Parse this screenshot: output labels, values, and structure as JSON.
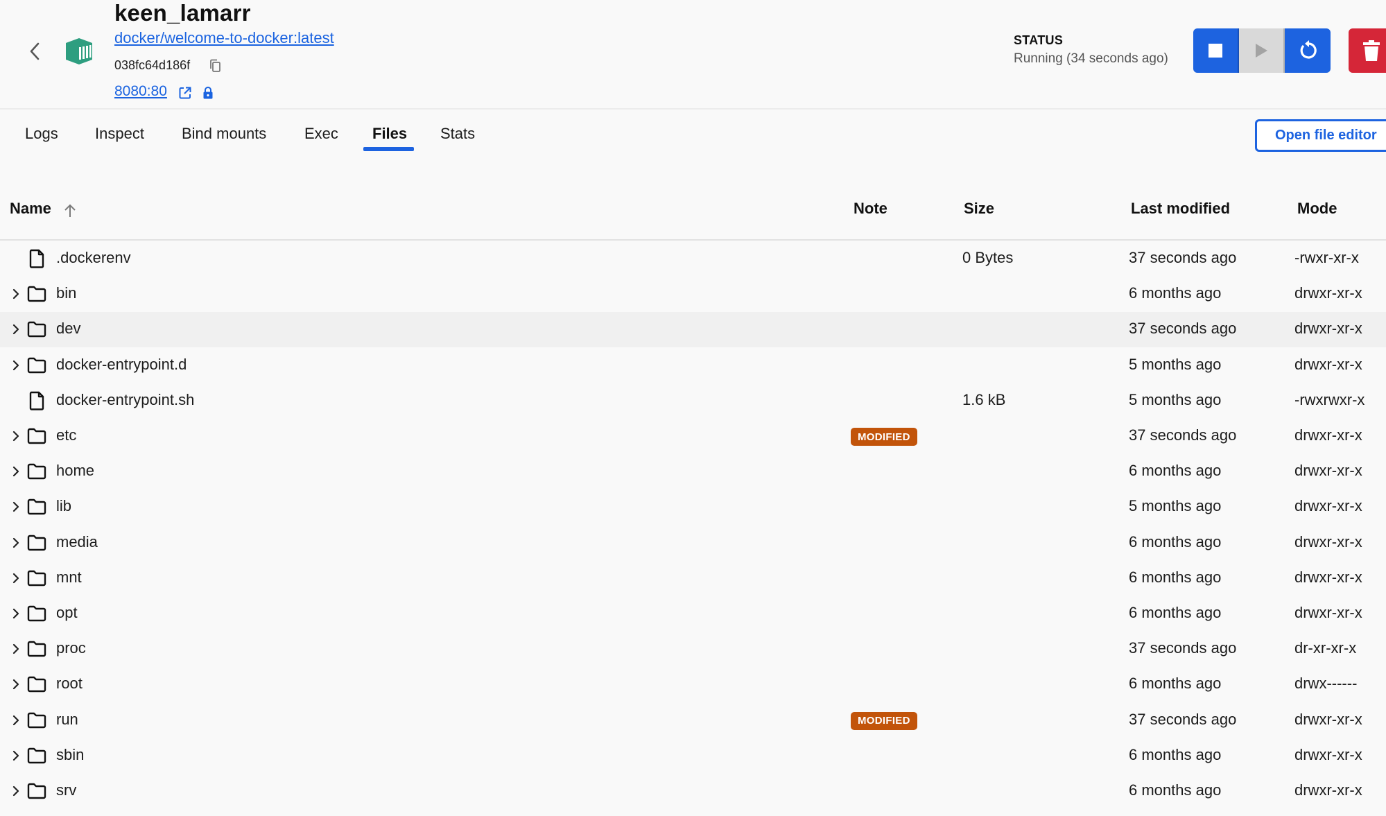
{
  "header": {
    "container_name": "keen_lamarr",
    "image_link": "docker/welcome-to-docker:latest",
    "container_id": "038fc64d186f",
    "port_link": "8080:80",
    "status_label": "STATUS",
    "status_value": "Running (34 seconds ago)",
    "icons": {
      "back": "chevron-left-icon",
      "container": "container-icon",
      "copy": "copy-icon",
      "external": "external-link-icon",
      "lock": "lock-icon",
      "stop": "stop-icon",
      "play": "play-icon",
      "restart": "restart-icon",
      "delete": "trash-icon"
    },
    "colors": {
      "primary": "#1d63e0",
      "danger": "#d52638",
      "disabled": "#d9d9d9",
      "container_icon": "#2e9e80"
    }
  },
  "tabs": [
    {
      "label": "Logs",
      "active": false
    },
    {
      "label": "Inspect",
      "active": false
    },
    {
      "label": "Bind mounts",
      "active": false
    },
    {
      "label": "Exec",
      "active": false
    },
    {
      "label": "Files",
      "active": true
    },
    {
      "label": "Stats",
      "active": false
    }
  ],
  "open_file_editor_label": "Open file editor",
  "table": {
    "columns": {
      "name": "Name",
      "note": "Note",
      "size": "Size",
      "last_modified": "Last modified",
      "mode": "Mode"
    },
    "sort": {
      "column": "Name",
      "direction": "ascending"
    },
    "badge_color": "#c2540a",
    "rows": [
      {
        "type": "file",
        "name": ".dockerenv",
        "note": "",
        "size": "0 Bytes",
        "modified": "37 seconds ago",
        "mode": "-rwxr-xr-x"
      },
      {
        "type": "folder",
        "name": "bin",
        "note": "",
        "size": "",
        "modified": "6 months ago",
        "mode": "drwxr-xr-x"
      },
      {
        "type": "folder",
        "name": "dev",
        "note": "",
        "size": "",
        "modified": "37 seconds ago",
        "mode": "drwxr-xr-x",
        "hovered": true
      },
      {
        "type": "folder",
        "name": "docker-entrypoint.d",
        "note": "",
        "size": "",
        "modified": "5 months ago",
        "mode": "drwxr-xr-x"
      },
      {
        "type": "file",
        "name": "docker-entrypoint.sh",
        "note": "",
        "size": "1.6 kB",
        "modified": "5 months ago",
        "mode": "-rwxrwxr-x"
      },
      {
        "type": "folder",
        "name": "etc",
        "note": "MODIFIED",
        "size": "",
        "modified": "37 seconds ago",
        "mode": "drwxr-xr-x"
      },
      {
        "type": "folder",
        "name": "home",
        "note": "",
        "size": "",
        "modified": "6 months ago",
        "mode": "drwxr-xr-x"
      },
      {
        "type": "folder",
        "name": "lib",
        "note": "",
        "size": "",
        "modified": "5 months ago",
        "mode": "drwxr-xr-x"
      },
      {
        "type": "folder",
        "name": "media",
        "note": "",
        "size": "",
        "modified": "6 months ago",
        "mode": "drwxr-xr-x"
      },
      {
        "type": "folder",
        "name": "mnt",
        "note": "",
        "size": "",
        "modified": "6 months ago",
        "mode": "drwxr-xr-x"
      },
      {
        "type": "folder",
        "name": "opt",
        "note": "",
        "size": "",
        "modified": "6 months ago",
        "mode": "drwxr-xr-x"
      },
      {
        "type": "folder",
        "name": "proc",
        "note": "",
        "size": "",
        "modified": "37 seconds ago",
        "mode": "dr-xr-xr-x"
      },
      {
        "type": "folder",
        "name": "root",
        "note": "",
        "size": "",
        "modified": "6 months ago",
        "mode": "drwx------"
      },
      {
        "type": "folder",
        "name": "run",
        "note": "MODIFIED",
        "size": "",
        "modified": "37 seconds ago",
        "mode": "drwxr-xr-x"
      },
      {
        "type": "folder",
        "name": "sbin",
        "note": "",
        "size": "",
        "modified": "6 months ago",
        "mode": "drwxr-xr-x"
      },
      {
        "type": "folder",
        "name": "srv",
        "note": "",
        "size": "",
        "modified": "6 months ago",
        "mode": "drwxr-xr-x"
      }
    ]
  }
}
